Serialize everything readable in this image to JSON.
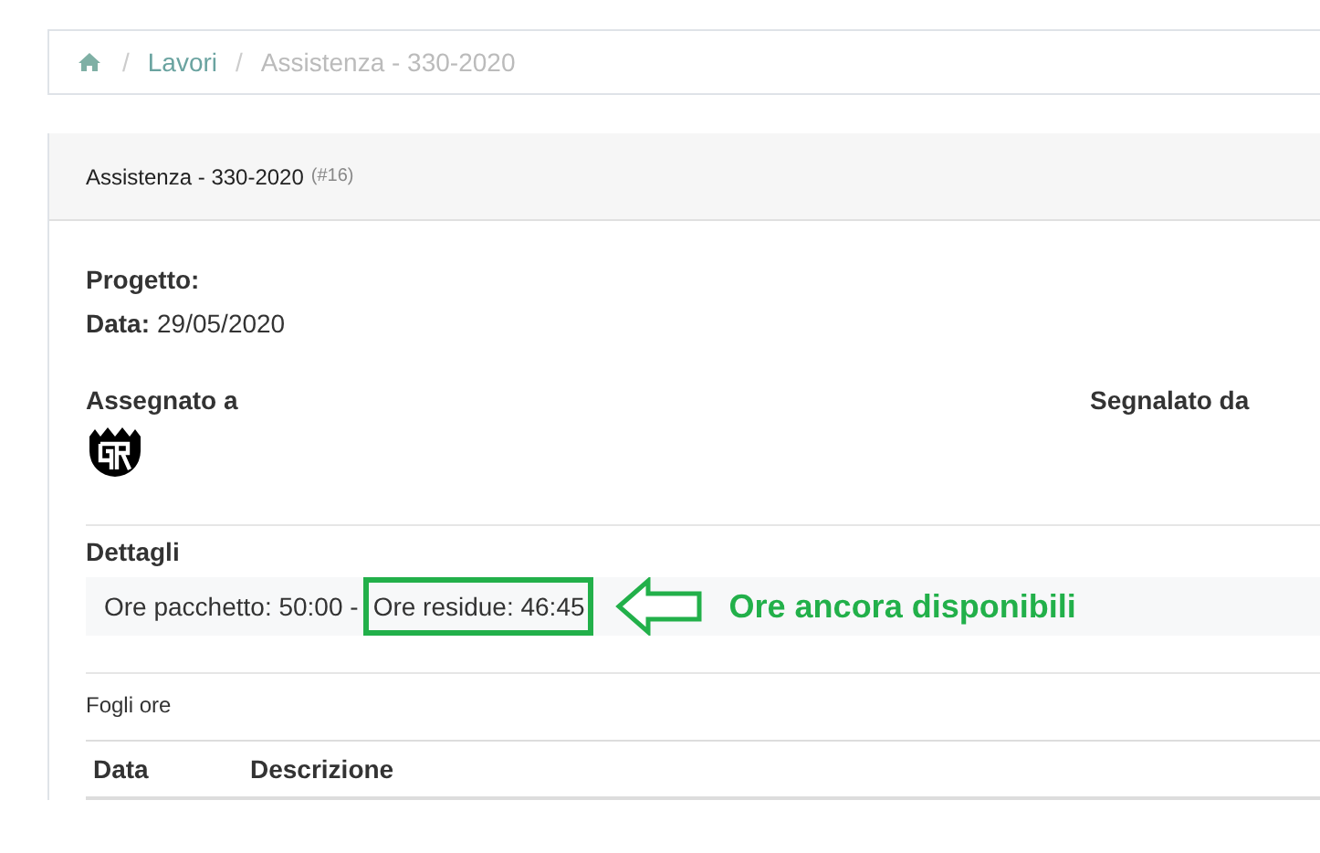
{
  "breadcrumb": {
    "separator": "/",
    "items": [
      {
        "label": "Lavori",
        "link": true
      },
      {
        "label": "Assistenza - 330-2020",
        "link": false
      }
    ]
  },
  "panel": {
    "title": "Assistenza - 330-2020",
    "number": "(#16)",
    "fields": [
      {
        "label": "Progetto:"
      },
      {
        "label": "Data:",
        "value": "29/05/2020"
      }
    ],
    "assigned_label": "Assegnato a",
    "reported_label": "Segnalato da",
    "details_label": "Dettagli",
    "details_text": "Ore pacchetto: 50:00 -",
    "details_highlight": "Ore residue: 46:45",
    "annotation": "Ore ancora disponibili",
    "timesheets_label": "Fogli ore",
    "table": {
      "columns": [
        "Data",
        "Descrizione"
      ]
    }
  }
}
